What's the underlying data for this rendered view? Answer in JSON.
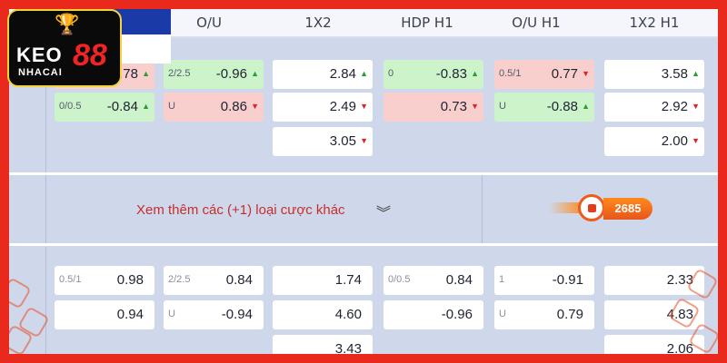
{
  "header": {
    "columns": [
      "O/U",
      "1X2",
      "HDP H1",
      "O/U H1",
      "1X2 H1"
    ]
  },
  "logo": {
    "text_top": "KEO",
    "text_bottom": "NHACAI",
    "number": "88"
  },
  "match1": {
    "hdp": [
      {
        "label": "",
        "value": ".78",
        "arrow": "up",
        "tone": "red"
      },
      {
        "label": "0/0.5",
        "value": "-0.84",
        "arrow": "up",
        "tone": "green"
      }
    ],
    "ou": [
      {
        "label": "2/2.5",
        "value": "-0.96",
        "arrow": "up",
        "tone": "green"
      },
      {
        "label": "U",
        "value": "0.86",
        "arrow": "down",
        "tone": "red"
      }
    ],
    "x12": [
      {
        "value": "2.84",
        "arrow": "up"
      },
      {
        "value": "2.49",
        "arrow": "down"
      },
      {
        "value": "3.05",
        "arrow": "down"
      }
    ],
    "hdp_h1": [
      {
        "label": "0",
        "value": "-0.83",
        "arrow": "up",
        "tone": "green"
      },
      {
        "label": "",
        "value": "0.73",
        "arrow": "down",
        "tone": "red"
      }
    ],
    "ou_h1": [
      {
        "label": "0.5/1",
        "value": "0.77",
        "arrow": "down",
        "tone": "red"
      },
      {
        "label": "U",
        "value": "-0.88",
        "arrow": "up",
        "tone": "green"
      }
    ],
    "x12_h1": [
      {
        "value": "3.58",
        "arrow": "up"
      },
      {
        "value": "2.92",
        "arrow": "down"
      },
      {
        "value": "2.00",
        "arrow": "down"
      }
    ]
  },
  "more_bets": {
    "text": "Xem thêm các (+1) loại cược khác",
    "badge": "2685"
  },
  "match2": {
    "hdp": [
      {
        "label": "0.5/1",
        "value": "0.98"
      },
      {
        "label": "",
        "value": "0.94"
      }
    ],
    "ou": [
      {
        "label": "2/2.5",
        "value": "0.84"
      },
      {
        "label": "U",
        "value": "-0.94"
      }
    ],
    "x12": [
      {
        "value": "1.74"
      },
      {
        "value": "4.60"
      },
      {
        "value": "3.43"
      }
    ],
    "hdp_h1": [
      {
        "label": "0/0.5",
        "value": "0.84"
      },
      {
        "label": "",
        "value": "-0.96"
      }
    ],
    "ou_h1": [
      {
        "label": "1",
        "value": "-0.91"
      },
      {
        "label": "U",
        "value": "0.79"
      }
    ],
    "x12_h1": [
      {
        "value": "2.33"
      },
      {
        "value": "4.83"
      },
      {
        "value": "2.06"
      }
    ]
  },
  "colors": {
    "frame": "#e8291b",
    "panel": "#cfd8ea",
    "up": "#2d9b33",
    "down": "#e02424",
    "green_cell": "#cdf3cb",
    "red_cell": "#f8cfcd"
  }
}
